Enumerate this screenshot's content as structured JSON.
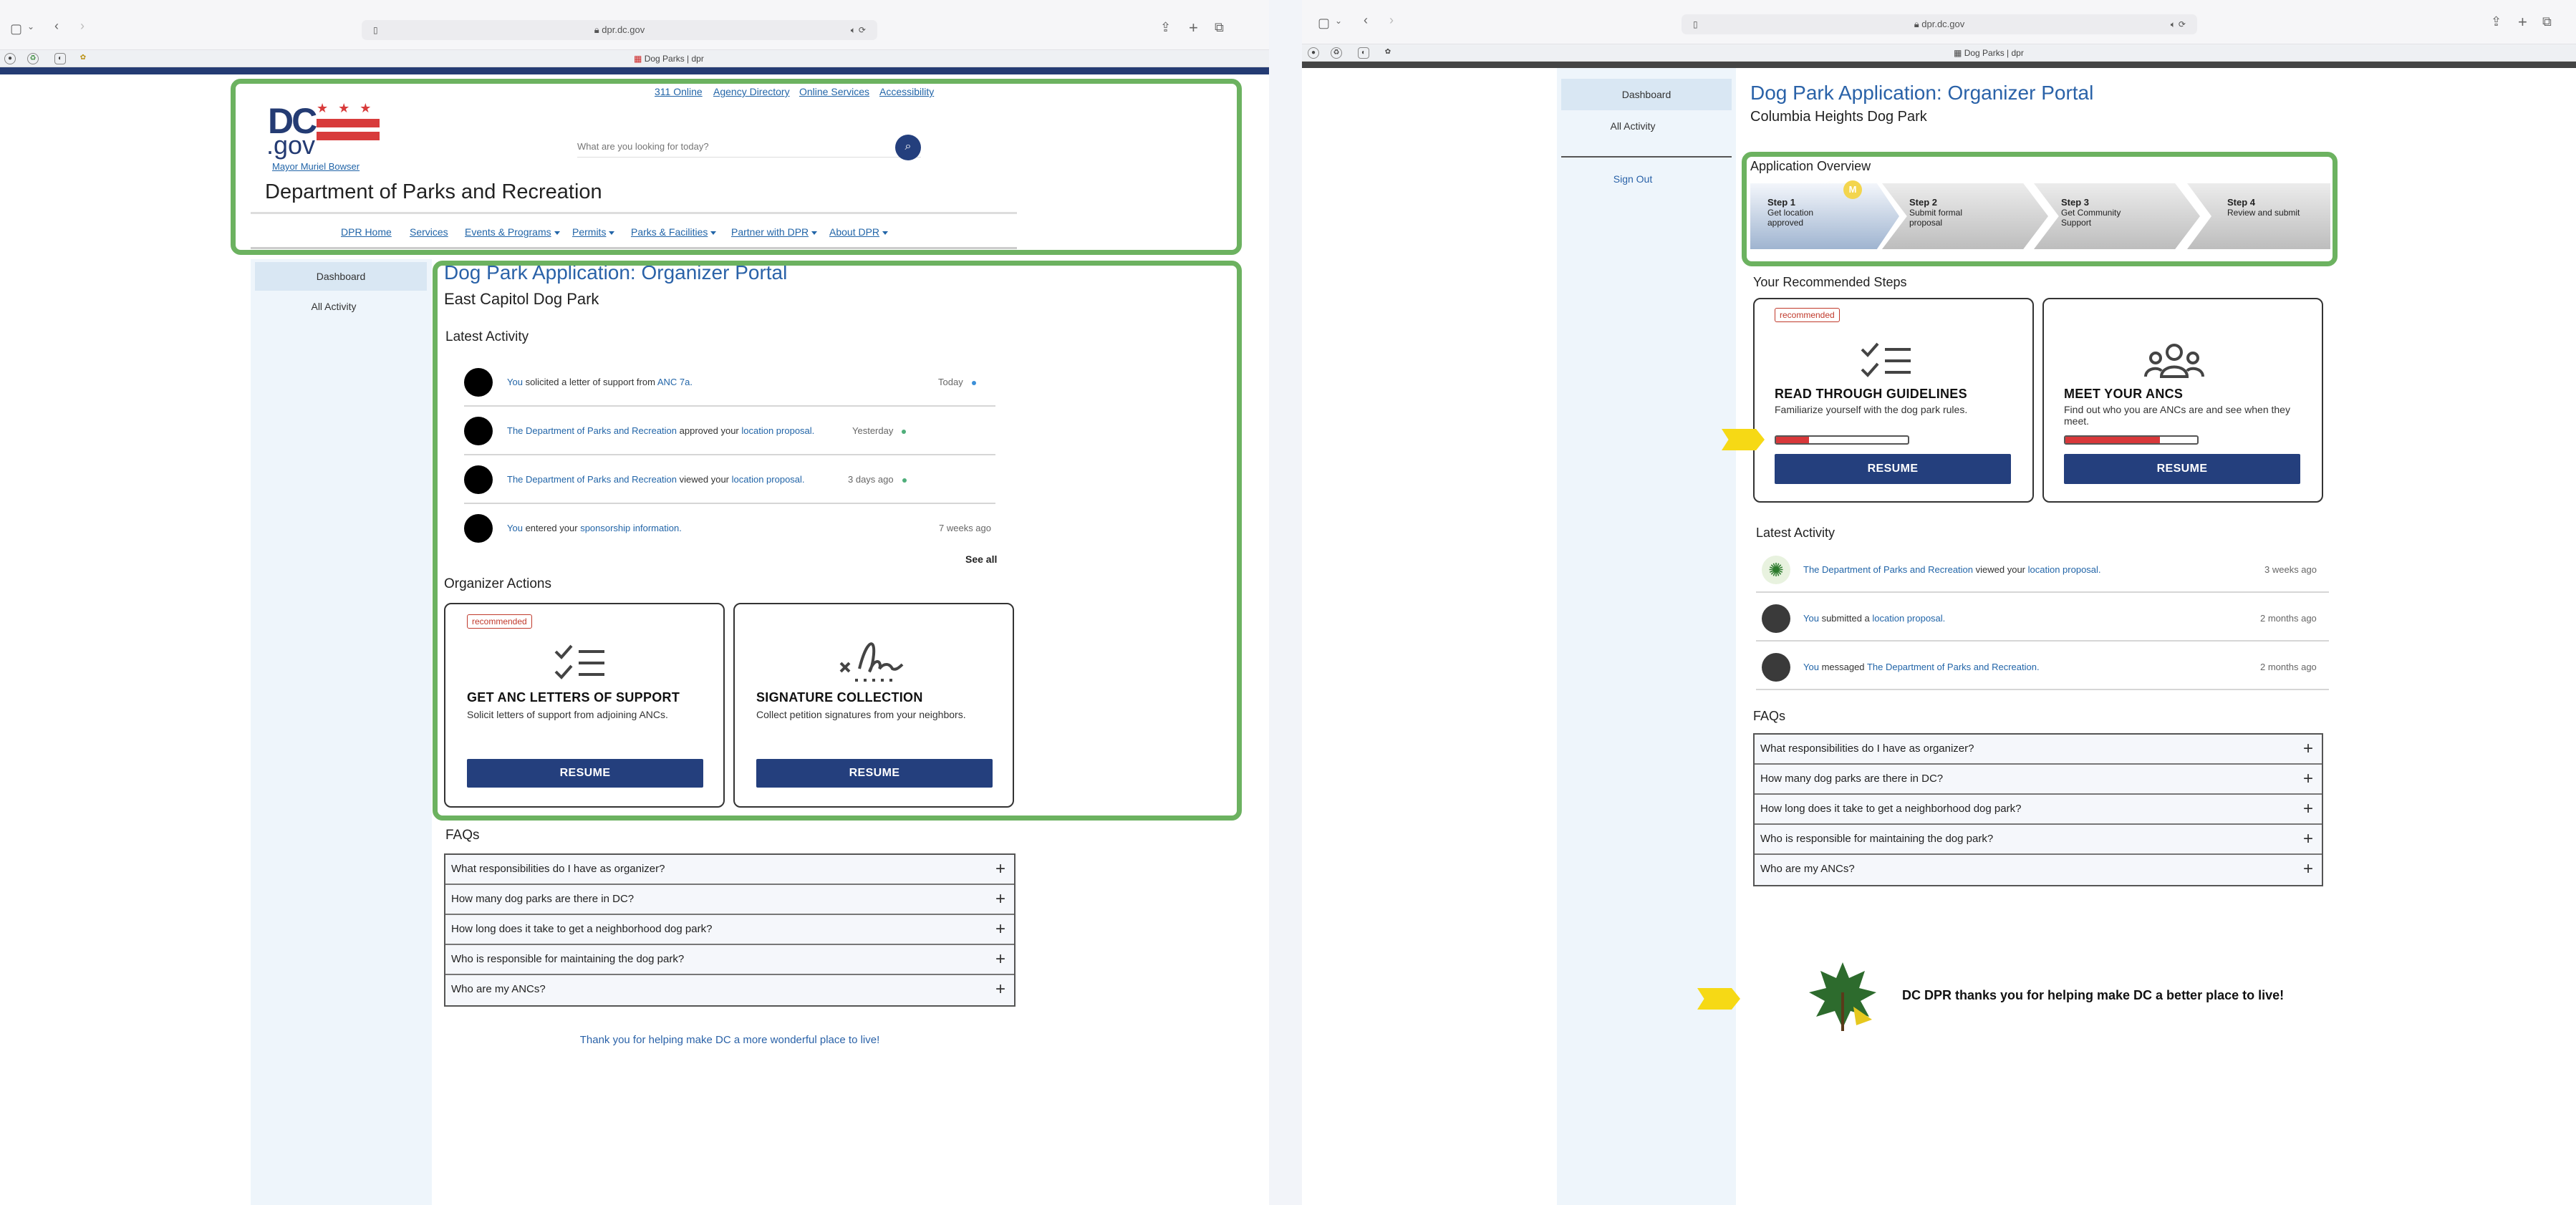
{
  "left": {
    "browser": {
      "url": "dpr.dc.gov",
      "tab_title": "Dog Parks | dpr"
    },
    "header": {
      "top_links": [
        "311 Online",
        "Agency Directory",
        "Online Services",
        "Accessibility"
      ],
      "logo_dc": "DC",
      "logo_gov": ".gov",
      "mayor_link": "Mayor Muriel Bowser",
      "search_placeholder": "What are you looking for today?",
      "dept_title": "Department of Parks and Recreation",
      "nav": [
        "DPR Home",
        "Services",
        "Events & Programs",
        "Permits",
        "Parks & Facilities",
        "Partner with DPR",
        "About DPR"
      ]
    },
    "sidebar": {
      "items": [
        "Dashboard",
        "All Activity"
      ]
    },
    "main": {
      "title": "Dog Park Application: Organizer Portal",
      "park": "East Capitol Dog Park",
      "latest_activity_heading": "Latest Activity",
      "activity": [
        {
          "actor": "You",
          "verb": "solicited a letter of support from",
          "object": "ANC 7a.",
          "time": "Today"
        },
        {
          "actor": "The Department of Parks and Recreation",
          "verb": "approved your",
          "object": "location proposal.",
          "time": "Yesterday"
        },
        {
          "actor": "The Department of Parks and Recreation",
          "verb": "viewed your",
          "object": "location proposal.",
          "time": "3 days ago"
        },
        {
          "actor": "You",
          "verb": "entered your",
          "object": "sponsorship information.",
          "time": "7 weeks ago"
        }
      ],
      "see_all": "See all",
      "actions_heading": "Organizer Actions",
      "cards": [
        {
          "badge": "recommended",
          "title": "GET ANC LETTERS OF SUPPORT",
          "desc": "Solicit letters of support from adjoining ANCs.",
          "button": "RESUME",
          "icon": "checklist-icon"
        },
        {
          "badge": "",
          "title": "SIGNATURE COLLECTION",
          "desc": "Collect petition signatures from your neighbors.",
          "button": "RESUME",
          "icon": "signature-icon"
        }
      ],
      "faqs_heading": "FAQs",
      "faqs": [
        "What responsibilities do I have as organizer?",
        "How many dog parks are there in DC?",
        "How long does it take to get a neighborhood dog park?",
        "Who is responsible for maintaining the dog park?",
        "Who are my ANCs?"
      ],
      "footer": "Thank you for helping make DC a more wonderful place to live!"
    }
  },
  "right": {
    "browser": {
      "url": "dpr.dc.gov",
      "tab_title": "Dog Parks | dpr"
    },
    "sidebar": {
      "items": [
        "Dashboard",
        "All Activity"
      ],
      "sign_out": "Sign Out"
    },
    "main": {
      "title": "Dog Park Application: Organizer Portal",
      "park": "Columbia Heights Dog Park",
      "overview_heading": "Application Overview",
      "steps": [
        {
          "step": "Step 1",
          "label": "Get location approved"
        },
        {
          "step": "Step 2",
          "label": "Submit formal proposal"
        },
        {
          "step": "Step 3",
          "label": "Get Community Support"
        },
        {
          "step": "Step 4",
          "label": "Review and submit"
        }
      ],
      "step_marker": "M",
      "recommended_heading": "Your Recommended Steps",
      "cards": [
        {
          "badge": "recommended",
          "title": "READ THROUGH GUIDELINES",
          "desc": "Familiarize yourself with the dog park rules.",
          "button": "RESUME",
          "progress": 0.25,
          "icon": "checklist-icon"
        },
        {
          "badge": "",
          "title": "MEET YOUR ANCS",
          "desc": "Find out who you are ANCs are and see when they meet.",
          "button": "RESUME",
          "progress": 0.72,
          "icon": "people-icon"
        }
      ],
      "latest_activity_heading": "Latest Activity",
      "activity": [
        {
          "actor": "The Department of Parks and Recreation",
          "verb": "viewed your",
          "object": "location proposal.",
          "time": "3 weeks ago"
        },
        {
          "actor": "You",
          "verb": "submitted a",
          "object": "location proposal.",
          "time": "2 months ago"
        },
        {
          "actor": "You",
          "verb": "messaged",
          "object": "The Department of Parks and Recreation.",
          "time": "2 months ago"
        }
      ],
      "faqs_heading": "FAQs",
      "faqs": [
        "What responsibilities do I have as organizer?",
        "How many dog parks are there in DC?",
        "How long does it take to get a neighborhood dog park?",
        "Who is responsible for maintaining the dog park?",
        "Who are my ANCs?"
      ],
      "footer": "DC DPR thanks you for helping make DC a better place to live!"
    }
  },
  "colors": {
    "accent": "#2a62a8",
    "button": "#243f7d",
    "green_highlight": "#6cb260",
    "badge_red": "#c0392b",
    "marker_yellow": "#f6d915"
  }
}
